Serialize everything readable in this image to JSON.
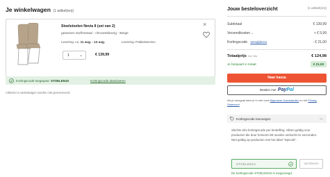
{
  "cart": {
    "title": "Je winkelwagen",
    "count_label": "(1 artikel(en))",
    "item": {
      "name": "Stoelstoelen Nevia II (set van 2)",
      "description": "geweven stof/metaal - chroomkleurig - Beige",
      "delivery_prefix": "Levering: ca.",
      "delivery_dates": "11 aug. - 14 aug.",
      "shipping": "Levering: Pakketservice",
      "quantity": "1",
      "price": "€ 139,99"
    },
    "coupon": {
      "applied_prefix": "Kortingscode toegepast:",
      "code": "STOELEN15",
      "deactivate_label": "Kortingscode deactiveren"
    },
    "saved_note": "Artikelen in winkelwagen worden niet gereserveerd."
  },
  "summary": {
    "title": "Jouw besteloverzicht",
    "count_label": "(1 artikel(en))",
    "subtotal_label": "Subtotaal",
    "subtotal_value": "€ 139,99",
    "shipping_label": "Verzendkosten",
    "shipping_value": "+ € 5,99",
    "discount_label": "Kortingscode",
    "discount_remove_label": "Verwijderen",
    "discount_value": "- € 21,00",
    "total_label": "Totaalprijs",
    "total_incl": "incl. btw",
    "total_value": "€ 124,98",
    "saved_label": "Je bespaart in totaal:",
    "saved_value": "€ 21,00",
    "checkout_label": "Naar kassa",
    "paypal_prefix": "Betalen met",
    "paypal_pay": "Pay",
    "paypal_pal": "Pal",
    "legal_text_1": "Als je doorgaat stem je in met onze",
    "legal_link_terms": "Algemene Voorwaarden",
    "legal_text_2": "en het",
    "legal_link_privacy": "Privacy Statement",
    "coupon_toggle_label": "Kortingscode toevoegen",
    "coupon_info": "Slechts één kortingscode per bestelling. Alleen geldig voor producten die door home24.SE worden verkocht en verzonden. Niet geldig op producten met het label \"Special\".",
    "coupon_input_value": "STOELEN15",
    "redeem_label": "Verzilveren",
    "coupon_success": "De kortingscode STOELEN15 is toegevoegd."
  },
  "colors": {
    "checkout": "#ee5433",
    "success": "#2f8a3a",
    "link": "#2a5aa8"
  }
}
